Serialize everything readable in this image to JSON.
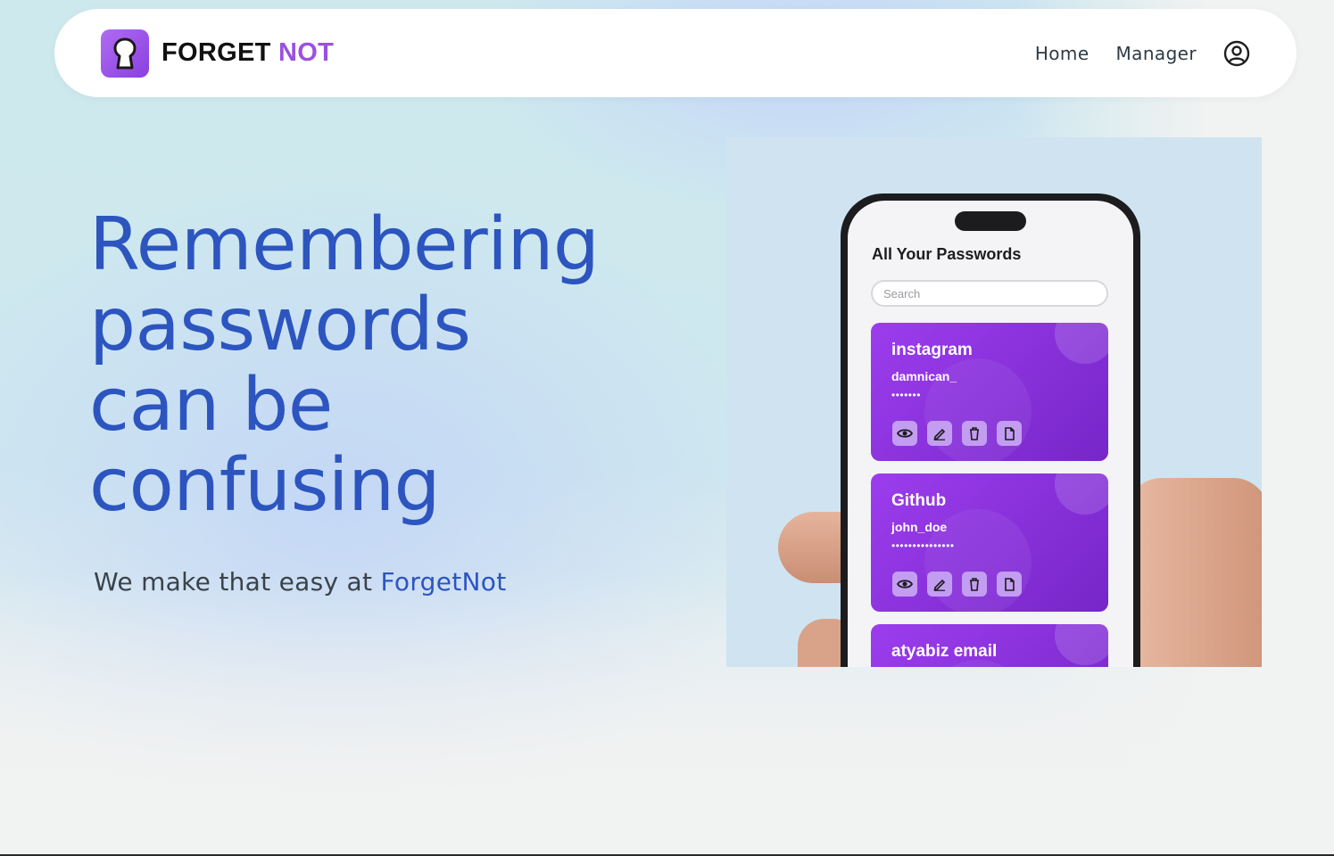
{
  "brand": {
    "name_part1": "FORGET",
    "name_part2": "NOT",
    "logo_icon": "keyhole-icon"
  },
  "nav": {
    "links": [
      {
        "label": "Home"
      },
      {
        "label": "Manager"
      }
    ],
    "profile_icon": "user-circle-icon"
  },
  "hero": {
    "title_lines": [
      "Remembering",
      "passwords",
      "can be",
      "confusing"
    ],
    "subtitle_prefix": "We make that easy at",
    "subtitle_accent": "ForgetNot"
  },
  "phone": {
    "screen_title": "All Your Passwords",
    "search_placeholder": "Search",
    "cards": [
      {
        "name": "instagram",
        "username": "damnican_",
        "password_mask": "•••••••"
      },
      {
        "name": "Github",
        "username": "john_doe",
        "password_mask": "•••••••••••••••"
      },
      {
        "name": "atyabiz email",
        "username": "",
        "password_mask": ""
      }
    ],
    "card_action_icons": [
      "eye-icon",
      "pencil-icon",
      "trash-icon",
      "copy-icon"
    ]
  },
  "colors": {
    "accent_blue": "#2c55bf",
    "brand_purple": "#9b51e0",
    "card_purple": "#8a33db"
  }
}
